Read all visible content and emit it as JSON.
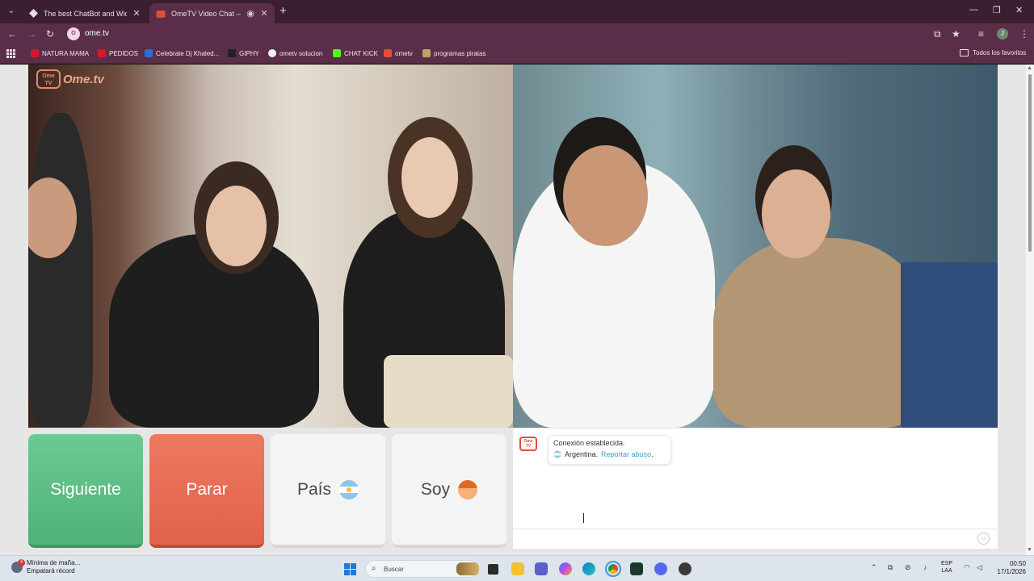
{
  "browser": {
    "tabs": [
      {
        "title": "The best ChatBot and Widgets"
      },
      {
        "title": "OmeTV Video Chat — Ome"
      }
    ],
    "url": "ome.tv",
    "site_chip": "O",
    "profile_initial": "J",
    "bookmarks": [
      {
        "label": "NATURA MAMA",
        "color": "#d6172a"
      },
      {
        "label": "PEDIDOS",
        "color": "#d6172a"
      },
      {
        "label": "Celebrate Dj Khaled...",
        "color": "#2a6fd6"
      },
      {
        "label": "GIPHY",
        "color": "#222222"
      },
      {
        "label": "ometv solucion",
        "color": "#f1f1f1"
      },
      {
        "label": "CHAT KICK",
        "color": "#53fc18"
      },
      {
        "label": "ometv",
        "color": "#e34b3a"
      },
      {
        "label": "programas piratas",
        "color": "#c2a060"
      }
    ],
    "favorites_label": "Todos los favoritos"
  },
  "app": {
    "logo": {
      "tv": "Ome TV",
      "wordmark": "Ome.tv"
    },
    "buttons": {
      "next": "Siguiente",
      "stop": "Parar",
      "country": "País",
      "iam": "Soy"
    },
    "chat": {
      "logo": "Ome TV",
      "status": "Conexión establecida.",
      "country": "Argentina.",
      "report_link": "Reportar abuso",
      "report_suffix": "."
    },
    "colors": {
      "next": "#5cbf84",
      "stop": "#e86c55",
      "accent": "#3aa0c8"
    }
  },
  "taskbar": {
    "weather": {
      "badge": "4",
      "line1": "Mínima de maña...",
      "line2": "Empatará récord"
    },
    "search_placeholder": "Buscar",
    "lang": {
      "line1": "ESP",
      "line2": "LAA"
    },
    "clock": {
      "time": "00:50",
      "date": "17/1/2026"
    }
  }
}
